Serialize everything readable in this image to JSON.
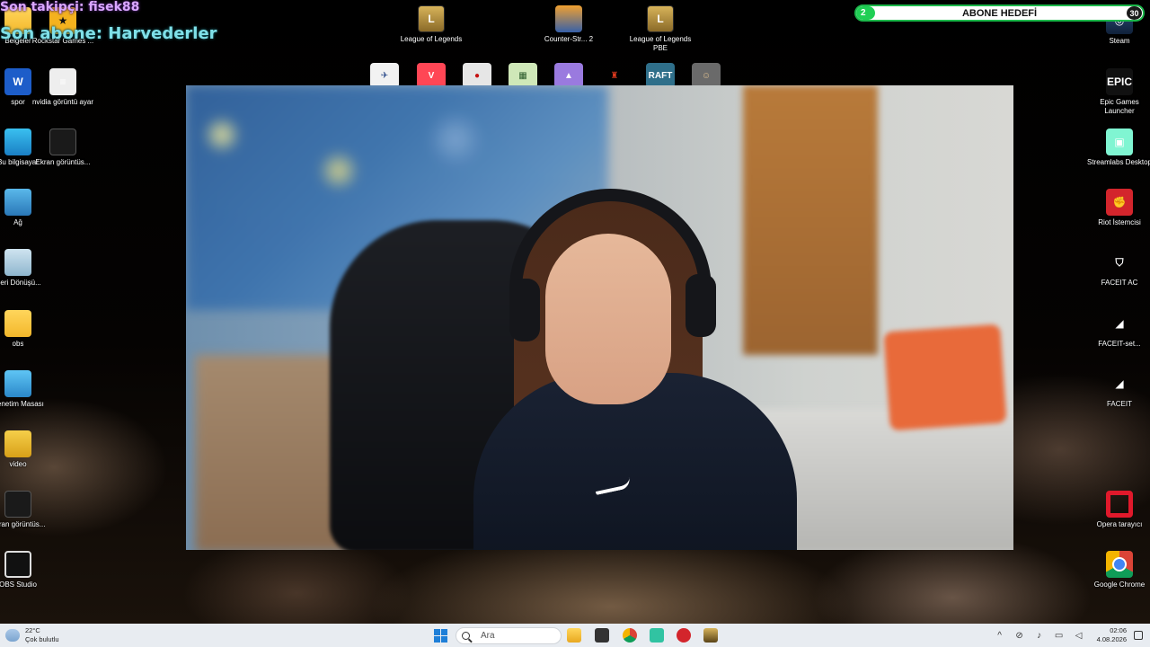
{
  "overlay": {
    "last_follower": "Son takipçi: fisek88",
    "last_subscriber": "Son abone: Harvederler"
  },
  "sub_goal": {
    "title": "ABONE HEDEFİ",
    "current": "2",
    "target": "30",
    "progress_fraction": 0.067,
    "bar_color": "#1fcf54"
  },
  "desktop": {
    "left_icons": [
      {
        "label": "Belgeler",
        "icon": "folder-icon"
      },
      {
        "label": "Rockstar Games ...",
        "icon": "rockstar-icon"
      },
      {
        "label": "spor",
        "icon": "word-document-icon"
      },
      {
        "label": "nvidia görüntü ayar",
        "icon": "document-icon"
      },
      {
        "label": "Bu bilgisayar",
        "icon": "computer-icon"
      },
      {
        "label": "Ekran görüntüs...",
        "icon": "screenshot-icon"
      },
      {
        "label": "Ağ",
        "icon": "network-icon"
      },
      {
        "label": "Geri Dönüşü...",
        "icon": "recycle-bin-icon"
      },
      {
        "label": "obs",
        "icon": "folder-icon"
      },
      {
        "label": "Denetim Masası",
        "icon": "control-panel-icon"
      },
      {
        "label": "video",
        "icon": "video-folder-icon"
      },
      {
        "label": "Ekran görüntüs...",
        "icon": "screenshot-icon"
      },
      {
        "label": "OBS Studio",
        "icon": "obs-icon"
      }
    ],
    "top_icons": [
      {
        "label": "League of Legends",
        "icon": "league-of-legends-icon"
      },
      {
        "label": "Counter-Str... 2",
        "icon": "counter-strike-icon"
      },
      {
        "label": "League of Legends PBE",
        "icon": "league-of-legends-pbe-icon"
      }
    ],
    "strip_icons": [
      "airplane-icon",
      "valorant-icon",
      "among-us-icon",
      "map-icon",
      "mountain-icon",
      "mario-icon",
      "raft-icon",
      "character-icon"
    ],
    "strip_raft_text": "RAFT",
    "right_icons": [
      {
        "label": "Steam",
        "icon": "steam-icon"
      },
      {
        "label": "Epic Games Launcher",
        "icon": "epic-games-icon",
        "glyph": "EPIC"
      },
      {
        "label": "Streamlabs Desktop",
        "icon": "streamlabs-icon"
      },
      {
        "label": "Riot İstemcisi",
        "icon": "riot-client-icon"
      },
      {
        "label": "FACEIT AC",
        "icon": "faceit-ac-icon"
      },
      {
        "label": "FACEIT-set...",
        "icon": "faceit-setup-icon"
      },
      {
        "label": "FACEIT",
        "icon": "faceit-icon"
      },
      {
        "label": "Opera tarayıcı",
        "icon": "opera-icon"
      },
      {
        "label": "Google Chrome",
        "icon": "chrome-icon"
      }
    ]
  },
  "taskbar": {
    "weather_temp": "22°C",
    "weather_desc": "Çok bulutlu",
    "search_placeholder": "Ara",
    "time": "02:06",
    "date": "4.08.2026",
    "pinned_apps": [
      "file-explorer-icon",
      "task-view-icon",
      "chrome-icon",
      "streamlabs-icon",
      "riot-client-icon",
      "league-of-legends-icon"
    ],
    "tray_icons": [
      "chevron-up-icon",
      "network-off-icon",
      "microphone-icon",
      "display-icon",
      "speaker-icon"
    ]
  },
  "colors": {
    "accent_green": "#1fcf54",
    "taskbar_bg": "#e8ecf1",
    "follower_text": "#d9a6ff",
    "subscriber_text": "#7fe0e8"
  }
}
